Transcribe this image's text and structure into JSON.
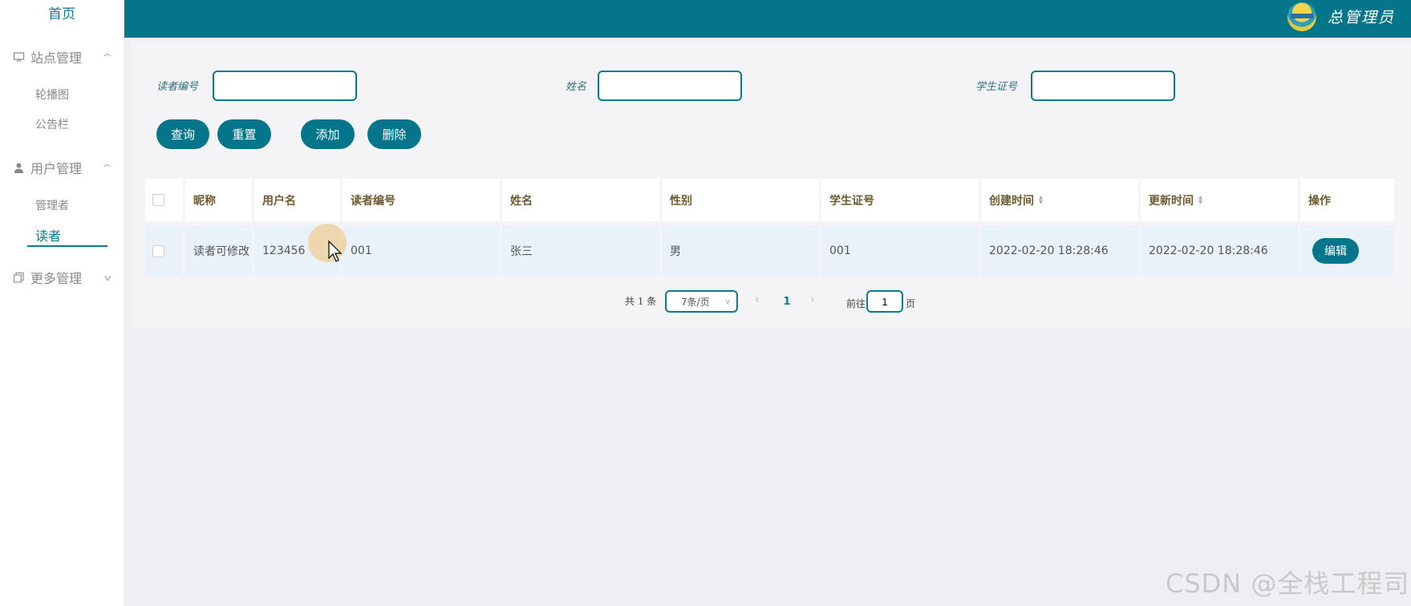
{
  "sidebar": {
    "home": "首页",
    "groups": [
      {
        "label": "站点管理",
        "icon": "monitor-icon",
        "expanded": true,
        "items": [
          "轮播图",
          "公告栏"
        ]
      },
      {
        "label": "用户管理",
        "icon": "user-icon",
        "expanded": true,
        "items": [
          "管理者",
          "读者"
        ]
      },
      {
        "label": "更多管理",
        "icon": "copy-icon",
        "expanded": false,
        "items": []
      }
    ],
    "active_item": "读者"
  },
  "header": {
    "admin_name": "总管理员",
    "avatar_icon": "avatar-icon",
    "bg_color": "#05758c"
  },
  "search": {
    "fields": [
      {
        "label": "读者编号",
        "value": "",
        "placeholder": ""
      },
      {
        "label": "姓名",
        "value": "",
        "placeholder": ""
      },
      {
        "label": "学生证号",
        "value": "",
        "placeholder": ""
      }
    ],
    "buttons": {
      "query": "查询",
      "reset": "重置",
      "add": "添加",
      "delete": "删除"
    }
  },
  "table": {
    "columns": [
      "昵称",
      "用户名",
      "读者编号",
      "姓名",
      "性别",
      "学生证号",
      "创建时间",
      "更新时间",
      "操作"
    ],
    "rows": [
      {
        "nickname": "读者可修改",
        "username": "123456",
        "reader_no": "001",
        "name": "张三",
        "gender": "男",
        "student_id": "001",
        "created": "2022-02-20 18:28:46",
        "updated": "2022-02-20 18:28:46",
        "action": "编辑"
      }
    ]
  },
  "pagination": {
    "total": "共 1 条",
    "page_size": "7条/页",
    "current_page": "1",
    "goto_label": "前往",
    "goto_value": "1",
    "page_suffix": "页"
  },
  "watermark": "CSDN @全栈工程司",
  "colors": {
    "accent": "#05758c",
    "row_bg": "#e8f2f8",
    "header_text": "#6e5a2f"
  }
}
